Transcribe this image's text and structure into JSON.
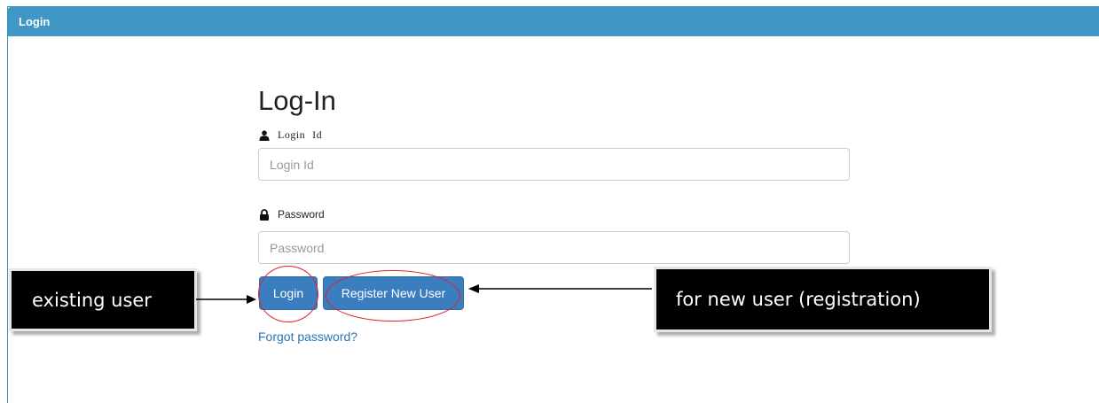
{
  "panel": {
    "title": "Login"
  },
  "form": {
    "title": "Log-In",
    "login_label_word1": "Login",
    "login_label_word2": "Id",
    "login_placeholder": "Login Id",
    "password_label": "Password",
    "password_placeholder": "Password",
    "login_button": "Login",
    "register_button": "Register New User",
    "forgot_link": "Forgot password?"
  },
  "annotations": {
    "existing_user": "existing user",
    "new_user": "for new user (registration)",
    "highlight_color": "#e0202a"
  },
  "icons": {
    "login_label_icon": "user-icon",
    "password_label_icon": "lock-icon"
  },
  "colors": {
    "header_bg": "#3e97c4",
    "button_bg": "#3a7ec0",
    "link": "#2a73b6"
  }
}
